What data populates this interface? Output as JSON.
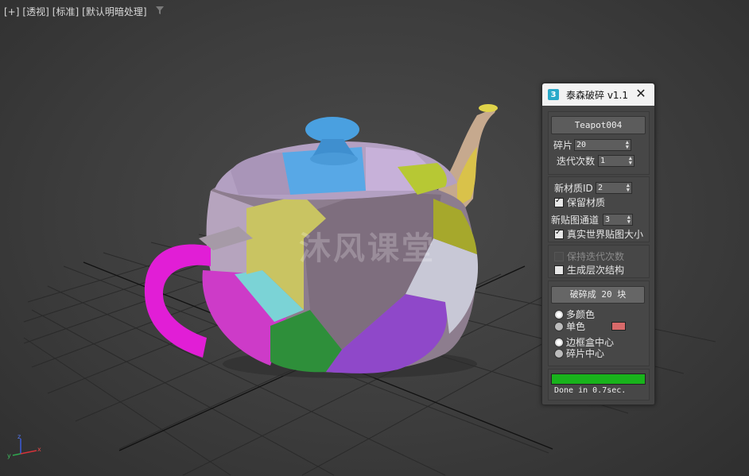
{
  "viewport": {
    "labels": [
      "[+]",
      "[透视]",
      "[标准]",
      "[默认明暗处理]"
    ],
    "filter_icon": "filter-icon",
    "watermark": "沐风课堂",
    "axis": {
      "x": "x",
      "y": "y",
      "z": "z"
    }
  },
  "panel": {
    "icon_text": "3",
    "title": "泰森破碎 v1.1",
    "close_icon": "✕",
    "object_button": "Teapot004",
    "fragments_label": "碎片",
    "fragments_value": "20",
    "iterations_label": "迭代次数",
    "iterations_value": "1",
    "material_id_label": "新材质ID",
    "material_id_value": "2",
    "keep_material_label": "保留材质",
    "map_channel_label": "新贴图通道",
    "map_channel_value": "3",
    "real_world_label": "真实世界贴图大小",
    "keep_iterations_label": "保持迭代次数",
    "hierarchy_label": "生成层次结构",
    "break_button": "破碎成 20 块",
    "multicolor_label": "多颜色",
    "single_color_label": "单色",
    "single_color_swatch": "#d86a6a",
    "bbox_center_label": "边框盒中心",
    "fragment_center_label": "碎片中心",
    "progress": 1.0,
    "progress_color": "#19b31c",
    "status": "Done in 0.7sec."
  }
}
